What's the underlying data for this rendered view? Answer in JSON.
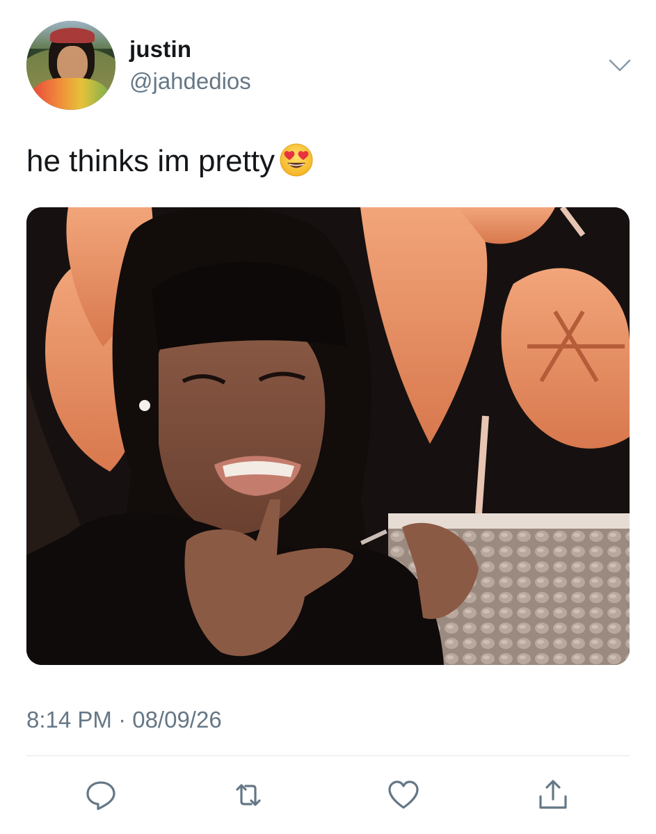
{
  "user": {
    "display_name": "justin",
    "handle": "@jahdedios",
    "avatar_icon": "avatar-photo"
  },
  "tweet": {
    "text": "he thinks im pretty",
    "emoji": "heart-eyes-emoji",
    "timestamp": "8:14 PM · 08/09/26"
  },
  "actions": [
    {
      "name": "reply",
      "icon": "speech-bubble-icon"
    },
    {
      "name": "retweet",
      "icon": "retweet-icon"
    },
    {
      "name": "like",
      "icon": "heart-icon"
    },
    {
      "name": "share",
      "icon": "share-icon"
    }
  ],
  "colors": {
    "primary_text": "#14171a",
    "secondary_text": "#657786",
    "divider": "#e1e8ed",
    "icon": "#657786"
  }
}
